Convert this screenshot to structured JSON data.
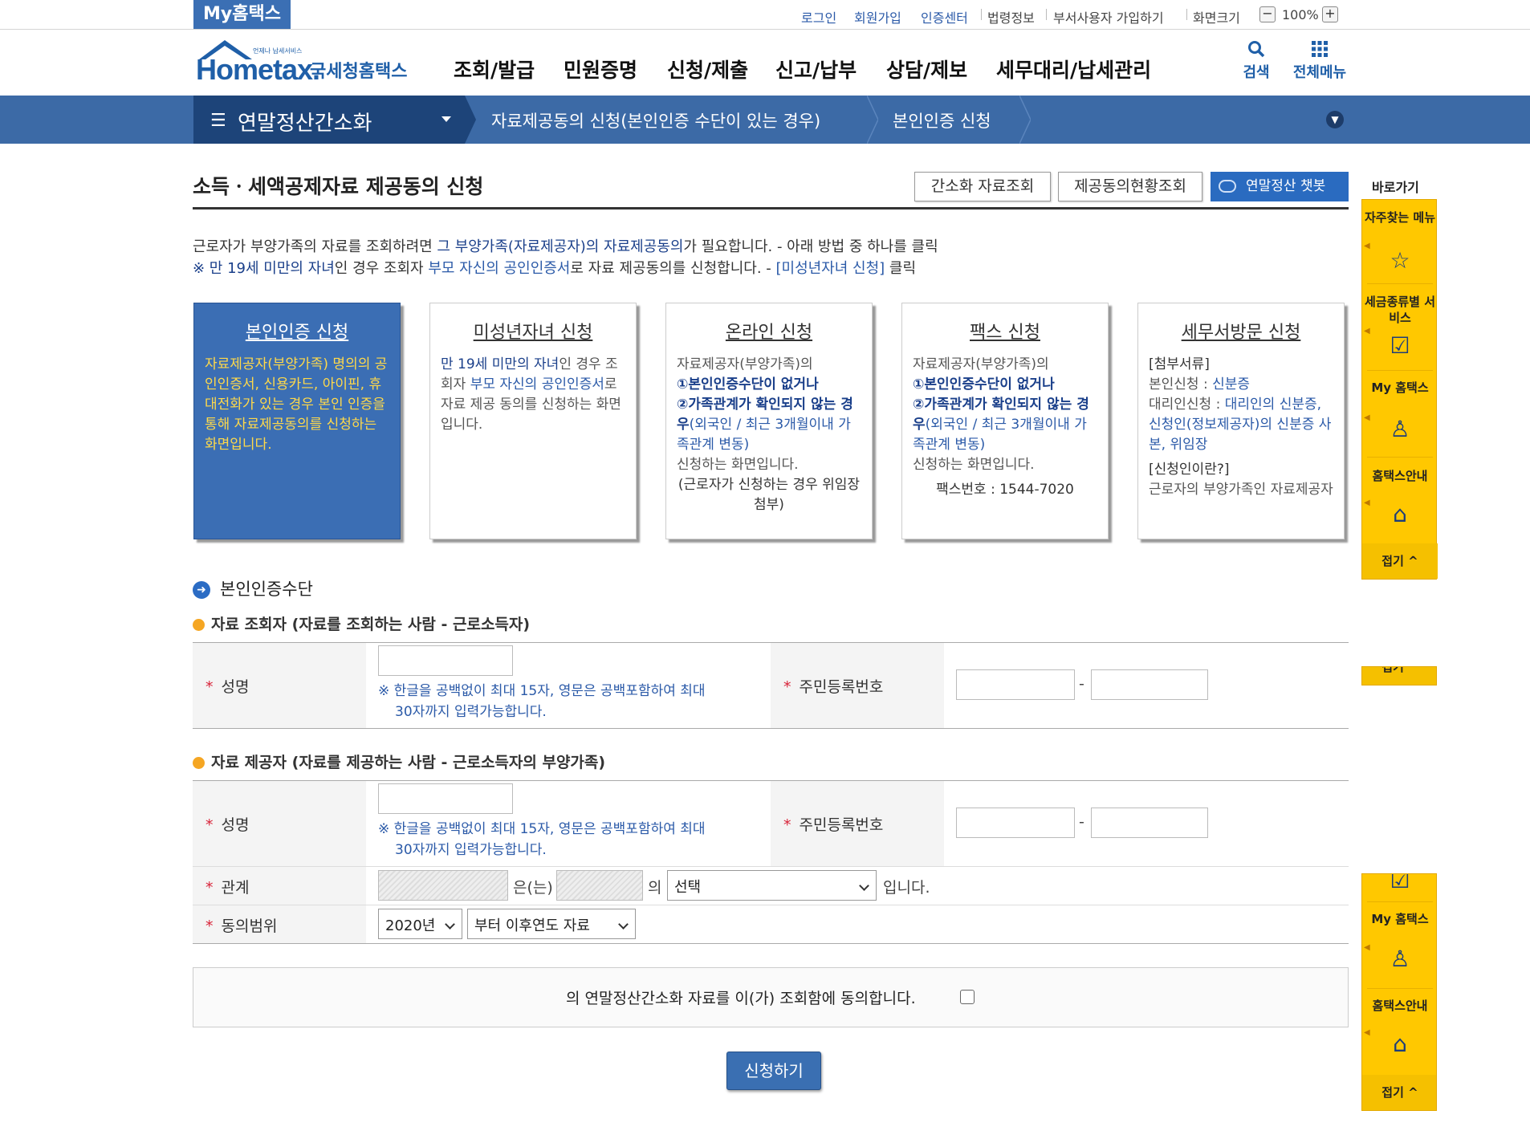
{
  "util": {
    "myhome_tab": "My홈택스",
    "login": "로그인",
    "signup": "회원가입",
    "cert_center": "인증센터",
    "law_info": "법령정보",
    "dept_user": "부서사용자 가입하기",
    "screen_size": "화면크기",
    "zoom": "100%",
    "zoom_minus": "−",
    "zoom_plus": "+"
  },
  "header": {
    "logo_text": "Hometax.",
    "logo_sub": "국세청홈택스",
    "logo_mini": "언제나 납세서비스",
    "gnb": [
      "조회/발급",
      "민원증명",
      "신청/제출",
      "신고/납부",
      "상담/제보",
      "세무대리/납세관리"
    ],
    "search": "검색",
    "all_menu": "전체메뉴"
  },
  "nav": {
    "title": "연말정산간소화",
    "crumbs": [
      "자료제공동의 신청(본인인증 수단이 있는 경우)",
      "본인인증 신청"
    ]
  },
  "page": {
    "title": "소득ㆍ세액공제자료 제공동의 신청",
    "buttons": {
      "simple_lookup": "간소화 자료조회",
      "consent_status": "제공동의현황조회",
      "chatbot": "연말정산 챗봇"
    },
    "intro1_a": "근로자가 부양가족의 자료를 조회하려면 ",
    "intro1_b": "그 부양가족(자료제공자)의 자료제공동의",
    "intro1_c": "가 필요합니다. - 아래 방법 중 하나를 클릭",
    "intro2_a": "※ 만 19세 미만의 자녀",
    "intro2_b": "인 경우 조회자 ",
    "intro2_c": "부모 자신의 공인인증서",
    "intro2_d": "로 자료 제공동의를 신청합니다. - ",
    "intro2_e": "[미성년자녀 신청]",
    "intro2_f": " 클릭"
  },
  "cards": [
    {
      "title": "본인인증 신청",
      "body": "자료제공자(부양가족) 명의의 공인인증서, 신용카드, 아이핀, 휴대전화가 있는 경우 본인 인증을 통해 자료제공동의를 신청하는 화면입니다."
    },
    {
      "title": "미성년자녀 신청",
      "body_a": "만 19세 미만의 자녀",
      "body_b": "인 경우 조회자 ",
      "body_c": "부모 자신의 공인인증서",
      "body_d": "로 자료 제공 동의를 신청하는 화면입니다."
    },
    {
      "title": "온라인 신청",
      "body_a": "자료제공자(부양가족)의",
      "body_b": "①본인인증수단이 없거나",
      "body_c": "②가족관계가 확인되지 않는 경우",
      "body_d": "(외국인 / 최근 3개월이내 가족관계 변동)",
      "body_e": "신청하는 화면입니다.",
      "body_f": "(근로자가 신청하는 경우 위임장 첨부)"
    },
    {
      "title": "팩스 신청",
      "body_a": "자료제공자(부양가족)의",
      "body_b": "①본인인증수단이 없거나",
      "body_c": "②가족관계가 확인되지 않는 경우",
      "body_d": "(외국인 / 최근 3개월이내 가족관계 변동)",
      "body_e": "신청하는 화면입니다.",
      "body_f": "팩스번호 : 1544-7020"
    },
    {
      "title": "세무서방문 신청",
      "body_a": "[첨부서류]",
      "body_b": "본인신청 : ",
      "body_c": "신분증",
      "body_d": "대리인신청 : ",
      "body_e": "대리인의 신분증, 신청인(정보제공자)의 신분증 사본, 위임장",
      "body_f": "[신청인이란?]",
      "body_g": "근로자의 부양가족인 자료제공자"
    }
  ],
  "form": {
    "section_title": "본인인증수단",
    "viewer_title": "자료 조회자 (자료를 조회하는 사람 - 근로소득자)",
    "provider_title": "자료 제공자 (자료를 제공하는 사람 - 근로소득자의 부양가족)",
    "name_label": "성명",
    "rrn_label": "주민등록번호",
    "name_hint_1": "※ 한글을 공백없이 최대 15자, 영문은 공백포함하여 최대",
    "name_hint_2": "30자까지 입력가능합니다.",
    "dash": "-",
    "relation_label": "관계",
    "relation_text_1": "은(는)",
    "relation_text_2": "의",
    "relation_select": "선택",
    "relation_text_3": "입니다.",
    "scope_label": "동의범위",
    "scope_year": "2020년",
    "scope_range": "부터 이후연도 자료",
    "required_mark": "*"
  },
  "agree": {
    "text": "의 연말정산간소화 자료를 이(가) 조회함에 동의합니다."
  },
  "submit": "신청하기",
  "quick": {
    "label": "바로가기",
    "favorites": "자주찾는 메뉴",
    "tax_service": "세금종류별 서비스",
    "my_hometax": "My 홈택스",
    "guide": "홈택스안내",
    "fold": "접기 ^",
    "fold_partial": "접기 ^"
  },
  "colors": {
    "brand_blue": "#1f5fa8",
    "nav_blue": "#3c6aa6",
    "nav_dark": "#1d4479",
    "quick_yellow": "#ffc800",
    "required_red": "#d8243a"
  }
}
